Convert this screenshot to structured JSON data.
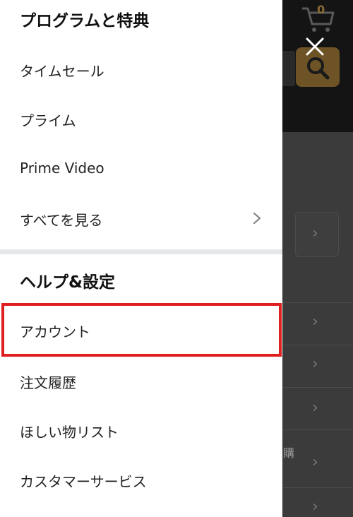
{
  "background": {
    "cart_count": "0",
    "partial_text": "購",
    "search_button_color": "#6e5326"
  },
  "drawer": {
    "sections": [
      {
        "title": "プログラムと特典",
        "items": [
          {
            "label": "タイムセール"
          },
          {
            "label": "プライム"
          },
          {
            "label": "Prime Video"
          },
          {
            "label": "すべてを見る",
            "icon": "chevron-right-icon"
          }
        ]
      },
      {
        "title": "ヘルプ&設定",
        "items": [
          {
            "label": "アカウント",
            "highlighted": true
          },
          {
            "label": "注文履歴"
          },
          {
            "label": "ほしい物リスト"
          },
          {
            "label": "カスタマーサービス"
          }
        ]
      }
    ],
    "highlight_color": "#e01e1e"
  },
  "close_icon": "close-icon"
}
